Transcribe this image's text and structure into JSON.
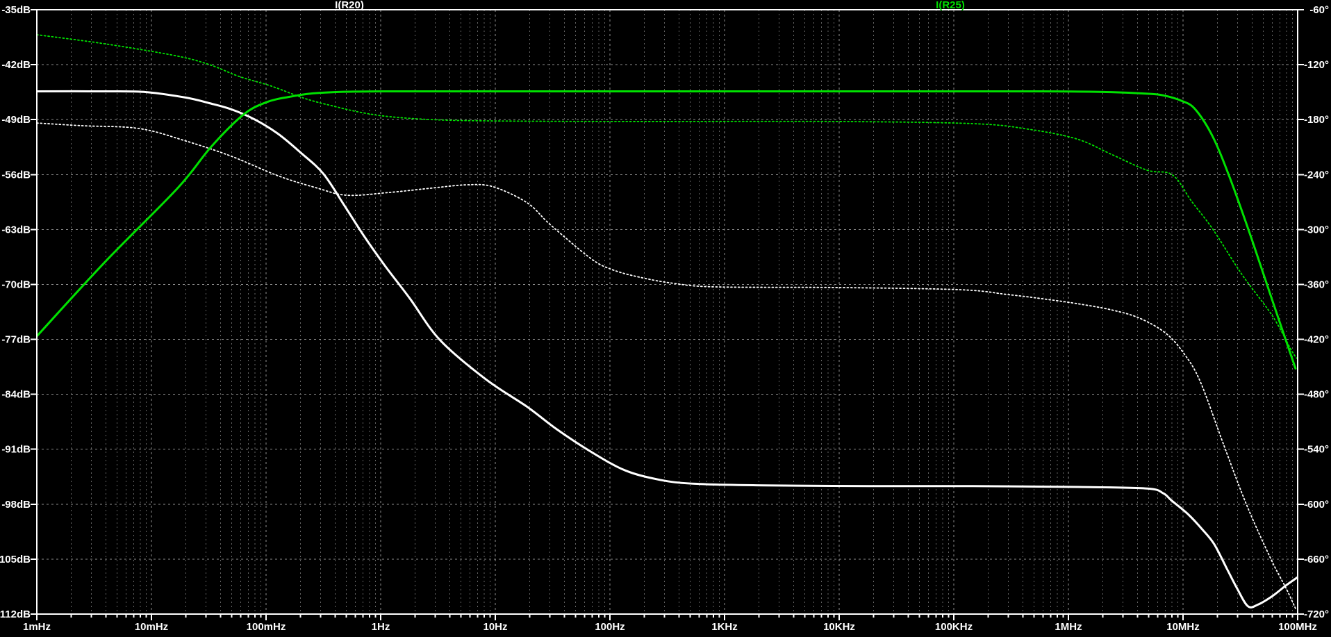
{
  "traces": [
    {
      "label": "I(R20)",
      "color": "#ffffff"
    },
    {
      "label": "I(R25)",
      "color": "#00e100"
    }
  ],
  "axes": {
    "left": {
      "labels": [
        "-35dB",
        "-42dB",
        "-49dB",
        "-56dB",
        "-63dB",
        "-70dB",
        "-77dB",
        "-84dB",
        "-91dB",
        "-98dB",
        "-105dB",
        "-112dB"
      ]
    },
    "right": {
      "labels": [
        "-60°",
        "-120°",
        "-180°",
        "-240°",
        "-300°",
        "-360°",
        "-420°",
        "-480°",
        "-540°",
        "-600°",
        "-660°",
        "-720°"
      ]
    },
    "bottom": {
      "labels": [
        "1mHz",
        "10mHz",
        "100mHz",
        "1Hz",
        "10Hz",
        "100Hz",
        "1KHz",
        "10KHz",
        "100KHz",
        "1MHz",
        "10MHz",
        "100MHz"
      ]
    }
  },
  "colors": {
    "background": "#000000",
    "axis": "#ffffff",
    "grid_major": "#8e8e8e",
    "grid_minor": "#666666"
  },
  "chart_data": {
    "type": "line",
    "x_scale": "log",
    "x_unit": "Hz",
    "x_range": [
      0.001,
      100000000
    ],
    "left_y": {
      "unit": "dB",
      "max": -35,
      "min": -112,
      "step": 7
    },
    "right_y": {
      "unit": "degrees",
      "max": -60,
      "min": -720,
      "step": 60
    },
    "grid": true,
    "legend_position": "top",
    "series": [
      {
        "name": "I(R20) magnitude",
        "color": "#ffffff",
        "style": "solid",
        "axis": "left",
        "points": [
          [
            0.001,
            -45.4
          ],
          [
            0.004,
            -45.4
          ],
          [
            0.009,
            -45.5
          ],
          [
            0.02,
            -46.2
          ],
          [
            0.032,
            -46.9
          ],
          [
            0.05,
            -47.7
          ],
          [
            0.08,
            -49.0
          ],
          [
            0.127,
            -50.8
          ],
          [
            0.2,
            -53.2
          ],
          [
            0.316,
            -55.9
          ],
          [
            0.48,
            -59.9
          ],
          [
            0.72,
            -63.9
          ],
          [
            1.1,
            -67.7
          ],
          [
            1.8,
            -71.8
          ],
          [
            3.3,
            -77.1
          ],
          [
            8.3,
            -82.1
          ],
          [
            19,
            -85.6
          ],
          [
            34,
            -88.4
          ],
          [
            68,
            -91.3
          ],
          [
            136,
            -93.7
          ],
          [
            273,
            -94.9
          ],
          [
            550,
            -95.4
          ],
          [
            2200,
            -95.6
          ],
          [
            18000,
            -95.7
          ],
          [
            147000,
            -95.7
          ],
          [
            1200000,
            -95.8
          ],
          [
            4840000,
            -96.0
          ],
          [
            6700000,
            -96.6
          ],
          [
            7900000,
            -97.5
          ],
          [
            11100000,
            -99.3
          ],
          [
            14700000,
            -101.2
          ],
          [
            18700000,
            -103.1
          ],
          [
            24100000,
            -106.2
          ],
          [
            29800000,
            -108.8
          ],
          [
            36800000,
            -111.0
          ],
          [
            45000000,
            -110.8
          ],
          [
            60300000,
            -109.7
          ],
          [
            79900000,
            -108.3
          ],
          [
            100000000,
            -107.3
          ]
        ]
      },
      {
        "name": "I(R20) phase",
        "color": "#ffffff",
        "style": "dotted",
        "axis": "right",
        "points": [
          [
            0.001,
            -183.7
          ],
          [
            0.0025,
            -186.7
          ],
          [
            0.0078,
            -189.7
          ],
          [
            0.02,
            -203.4
          ],
          [
            0.05,
            -220.1
          ],
          [
            0.127,
            -241.3
          ],
          [
            0.27,
            -254.2
          ],
          [
            0.51,
            -262.6
          ],
          [
            1.2,
            -259.5
          ],
          [
            2.7,
            -255.0
          ],
          [
            5.7,
            -251.2
          ],
          [
            9.6,
            -253.4
          ],
          [
            19,
            -270.9
          ],
          [
            30,
            -294.4
          ],
          [
            68,
            -331.6
          ],
          [
            104,
            -343.7
          ],
          [
            181,
            -352.1
          ],
          [
            363,
            -358.9
          ],
          [
            835,
            -362.7
          ],
          [
            9300,
            -363.4
          ],
          [
            111000,
            -365.7
          ],
          [
            294000,
            -371.0
          ],
          [
            589000,
            -375.6
          ],
          [
            1180000,
            -380.9
          ],
          [
            2360000,
            -387.7
          ],
          [
            4170000,
            -396.8
          ],
          [
            7100000,
            -413.5
          ],
          [
            10300000,
            -436.3
          ],
          [
            14200000,
            -466.6
          ],
          [
            22600000,
            -534.9
          ],
          [
            35700000,
            -600.1
          ],
          [
            58500000,
            -660.1
          ],
          [
            79900000,
            -692.7
          ],
          [
            97000000,
            -715.4
          ]
        ]
      },
      {
        "name": "I(R25) magnitude",
        "color": "#00e100",
        "style": "solid",
        "axis": "left",
        "points": [
          [
            0.001,
            -76.6
          ],
          [
            0.0039,
            -67.2
          ],
          [
            0.017,
            -57.7
          ],
          [
            0.033,
            -52.5
          ],
          [
            0.063,
            -48.4
          ],
          [
            0.1,
            -46.8
          ],
          [
            0.16,
            -46.1
          ],
          [
            0.29,
            -45.6
          ],
          [
            1,
            -45.4
          ],
          [
            34,
            -45.4
          ],
          [
            9300,
            -45.4
          ],
          [
            589000,
            -45.4
          ],
          [
            2360000,
            -45.5
          ],
          [
            4840000,
            -45.7
          ],
          [
            6670000,
            -45.9
          ],
          [
            9700000,
            -46.6
          ],
          [
            12800000,
            -47.7
          ],
          [
            18200000,
            -51.2
          ],
          [
            25900000,
            -56.6
          ],
          [
            39500000,
            -64.1
          ],
          [
            60300000,
            -72.1
          ],
          [
            95800000,
            -80.7
          ]
        ]
      },
      {
        "name": "I(R25) phase",
        "color": "#00e100",
        "style": "dotted",
        "axis": "right",
        "points": [
          [
            0.001,
            -87.3
          ],
          [
            0.0039,
            -97.2
          ],
          [
            0.016,
            -110.1
          ],
          [
            0.032,
            -119.9
          ],
          [
            0.058,
            -132.8
          ],
          [
            0.111,
            -143.4
          ],
          [
            0.22,
            -157.1
          ],
          [
            0.39,
            -165.4
          ],
          [
            0.68,
            -172.3
          ],
          [
            1.2,
            -176.8
          ],
          [
            2.7,
            -179.9
          ],
          [
            8.3,
            -181.4
          ],
          [
            136,
            -182.1
          ],
          [
            9300,
            -182.1
          ],
          [
            147000,
            -184.4
          ],
          [
            448000,
            -190.5
          ],
          [
            1180000,
            -201.1
          ],
          [
            2360000,
            -217.8
          ],
          [
            4840000,
            -235.2
          ],
          [
            8100000,
            -240.5
          ],
          [
            11900000,
            -269.4
          ],
          [
            18200000,
            -299.7
          ],
          [
            32600000,
            -349.0
          ],
          [
            60300000,
            -394.5
          ],
          [
            89400000,
            -433.2
          ],
          [
            100000000,
            -441.5
          ]
        ]
      }
    ]
  }
}
